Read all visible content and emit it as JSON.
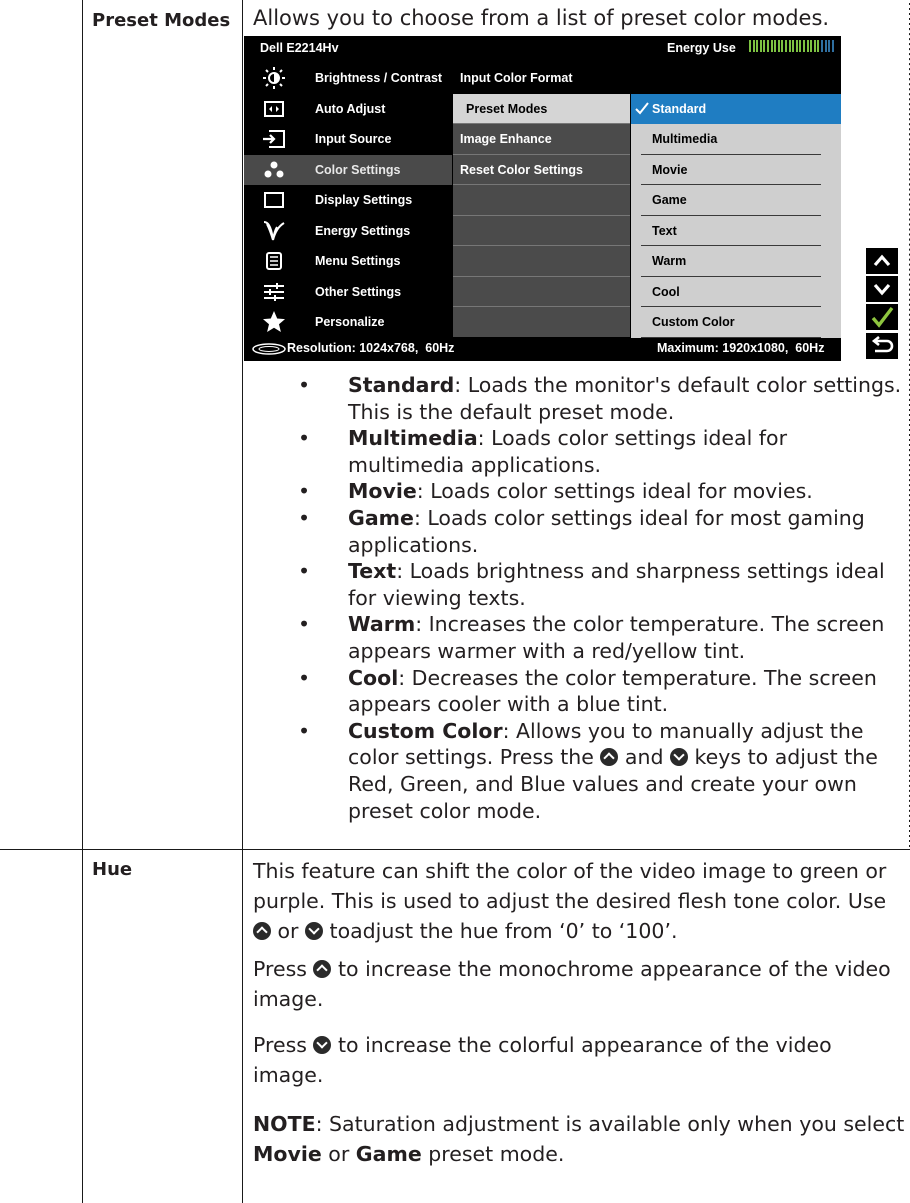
{
  "row1": {
    "label": "Preset Modes",
    "intro": "Allows you to choose from a list of preset color modes."
  },
  "osd": {
    "model": "Dell E2214Hv",
    "energy_label": "Energy Use",
    "main_menu": [
      {
        "label": "Brightness / Contrast",
        "icon": "brightness-icon"
      },
      {
        "label": "Auto Adjust",
        "icon": "auto-adjust-icon"
      },
      {
        "label": "Input Source",
        "icon": "input-source-icon"
      },
      {
        "label": "Color Settings",
        "icon": "color-settings-icon"
      },
      {
        "label": "Display Settings",
        "icon": "display-settings-icon"
      },
      {
        "label": "Energy Settings",
        "icon": "energy-settings-icon"
      },
      {
        "label": "Menu Settings",
        "icon": "menu-settings-icon"
      },
      {
        "label": "Other Settings",
        "icon": "other-settings-icon"
      },
      {
        "label": "Personalize",
        "icon": "star-icon"
      }
    ],
    "sub_menu": [
      "Input Color Format",
      "Preset Modes",
      "Image Enhance",
      "Reset Color Settings"
    ],
    "options": [
      "Standard",
      "Multimedia",
      "Movie",
      "Game",
      "Text",
      "Warm",
      "Cool",
      "Custom Color"
    ],
    "resolution": "Resolution: 1024x768,  60Hz",
    "maximum": "Maximum: 1920x1080,  60Hz",
    "selected_color": "#1f7dc2",
    "keys": [
      "up-arrow-icon",
      "down-arrow-icon",
      "check-icon",
      "back-icon"
    ]
  },
  "bullets": [
    {
      "term": "Standard",
      "desc": ": Loads the monitor's default color settings. This is the default preset mode."
    },
    {
      "term": "Multimedia",
      "desc": ": Loads color settings ideal for multimedia applications."
    },
    {
      "term": "Movie",
      "desc": ": Loads color settings ideal for movies."
    },
    {
      "term": "Game",
      "desc": ": Loads color settings ideal for most gaming applications."
    },
    {
      "term": "Text",
      "desc": ": Loads brightness and sharpness settings ideal for viewing texts."
    },
    {
      "term": "Warm",
      "desc": ": Increases the color temperature. The screen appears warmer with a red/yellow tint."
    },
    {
      "term": "Cool",
      "desc": ": Decreases the color temperature. The screen appears cooler with a blue tint."
    }
  ],
  "custom": {
    "term": "Custom Color",
    "a": ": Allows you to manually adjust the color settings. Press the ",
    "b": " and ",
    "c": " keys to adjust the Red, Green, and Blue values and create your own preset color mode."
  },
  "row2": {
    "label": "Hue",
    "p1": "This feature can shift the color of the video image to green or purple. This is used to adjust the desired flesh tone color. Use ",
    "p1b": " or ",
    "p1c": " toadjust the hue from ‘0’ to ‘100’.",
    "p2a": "Press ",
    "p2b": " to increase the monochrome appearance of the video image.",
    "p3a": "Press ",
    "p3b": " to increase the colorful appearance of the video image.",
    "note_label": "NOTE",
    "note_a": ": Saturation adjustment is available only when you select ",
    "note_movie": "Movie",
    "note_or": " or ",
    "note_game": "Game",
    "note_b": " preset mode."
  }
}
